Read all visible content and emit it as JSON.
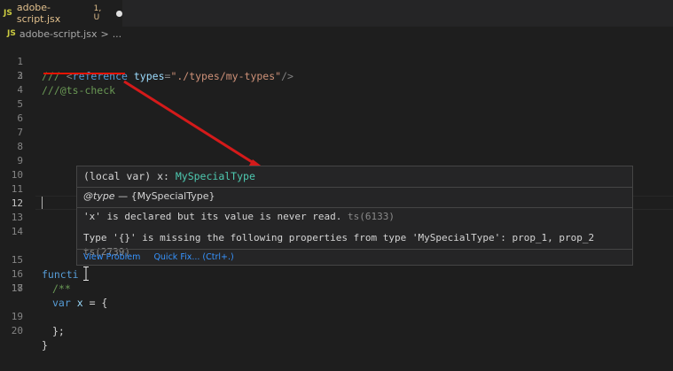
{
  "tab": {
    "badge": "JS",
    "filename": "adobe-script.jsx",
    "status": "1, U"
  },
  "breadcrumb": {
    "badge": "JS",
    "file": "adobe-script.jsx",
    "separator": ">",
    "ellipsis": "..."
  },
  "editor": {
    "active_line": 12,
    "lines": [
      {
        "n": "1"
      },
      {
        "n": "2"
      },
      {
        "n": "3"
      },
      {
        "n": "4"
      },
      {
        "n": "5"
      },
      {
        "n": "6"
      },
      {
        "n": "7"
      },
      {
        "n": "8"
      },
      {
        "n": "9"
      },
      {
        "n": "10"
      },
      {
        "n": "11"
      },
      {
        "n": "12"
      },
      {
        "n": "13"
      },
      {
        "n": "14"
      },
      {
        "n": "15"
      },
      {
        "n": "16"
      },
      {
        "n": "17"
      },
      {
        "n": "18"
      },
      {
        "n": "19"
      },
      {
        "n": "20"
      }
    ],
    "code": {
      "l1_slashes": "/// ",
      "l1_open": "<",
      "l1_tag": "reference",
      "l1_attr": " types",
      "l1_eq": "=",
      "l1_str": "\"./types/my-types\"",
      "l1_close": "/>",
      "l2": "///@ts-check",
      "l15": "functi",
      "l16": "/**",
      "l17_kw": "var",
      "l17_var": "x",
      "l17_rest": " = {",
      "l19": "};",
      "l20": "}"
    }
  },
  "hover": {
    "signature_prefix": "(local var) x: ",
    "signature_type": "MySpecialType",
    "jsdoc_tag": "@type",
    "jsdoc_text": " — {MySpecialType}",
    "msg1": "'x' is declared but its value is never read.",
    "msg1_code": " ts(6133)",
    "msg2": "Type '{}' is missing the following properties from type 'MySpecialType': prop_1, prop_2",
    "msg2_code": " ts(2739)",
    "view_problem": "View Problem",
    "quick_fix": "Quick Fix... (Ctrl+.)"
  },
  "colors": {
    "annotation_red": "#e51400",
    "link": "#3794ff",
    "type": "#4ec9b0"
  }
}
